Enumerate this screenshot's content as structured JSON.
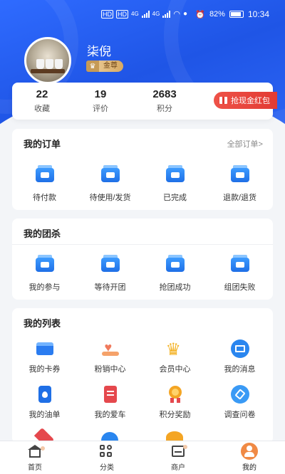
{
  "status_bar": {
    "hd1": "HD",
    "hd2": "HD",
    "sig1": "4G",
    "sig2": "4G",
    "battery": "82%",
    "time": "10:34"
  },
  "profile": {
    "name": "柒倪",
    "badge": "金尊"
  },
  "stats": [
    {
      "value": "22",
      "label": "收藏"
    },
    {
      "value": "19",
      "label": "评价"
    },
    {
      "value": "2683",
      "label": "积分"
    }
  ],
  "red_packet": "抢现金红包",
  "orders": {
    "title": "我的订单",
    "link": "全部订单>",
    "items": [
      "待付款",
      "待使用/发货",
      "已完成",
      "退款/退货"
    ]
  },
  "group": {
    "title": "我的团杀",
    "items": [
      "我的参与",
      "等待开团",
      "抢团成功",
      "组团失败"
    ]
  },
  "list": {
    "title": "我的列表",
    "items": [
      "我的卡券",
      "粉销中心",
      "会员中心",
      "我的消息",
      "我的油单",
      "我的爱车",
      "积分奖励",
      "调查问卷"
    ]
  },
  "nav": [
    "首页",
    "分类",
    "商户",
    "我的"
  ],
  "colors": {
    "primary": "#1f5ae8",
    "accent_red": "#e23b33",
    "gold": "#d8aa62",
    "me_orange": "#f08a45"
  }
}
